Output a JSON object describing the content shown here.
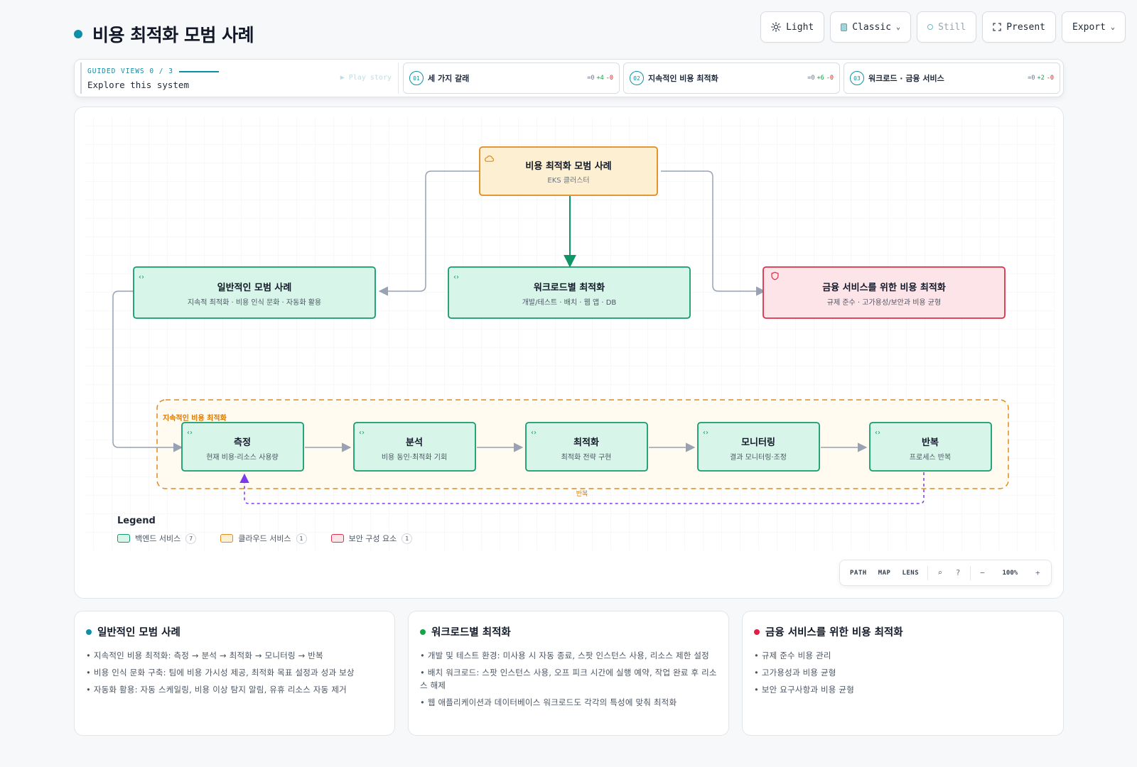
{
  "header": {
    "title": "비용 최적화 모범 사례",
    "accent": "#0e8fa8"
  },
  "toolbar": {
    "theme_label": "Light",
    "style_label": "Classic",
    "motion_label": "Still",
    "present_label": "Present",
    "export_label": "Export"
  },
  "guided": {
    "heading": "GUIDED VIEWS 0 / 3",
    "subtitle": "Explore this system",
    "play_label": "▶ Play story",
    "views": [
      {
        "num": "01",
        "label": "세 가지 갈래",
        "eq": "=0",
        "plus": "+4",
        "minus": "-0"
      },
      {
        "num": "02",
        "label": "지속적인 비용 최적화",
        "eq": "=0",
        "plus": "+6",
        "minus": "-0"
      },
      {
        "num": "03",
        "label": "워크로드 · 금융 서비스",
        "eq": "=0",
        "plus": "+2",
        "minus": "-0"
      }
    ]
  },
  "diagram": {
    "root": {
      "title": "비용 최적화 모범 사례",
      "sub": "EKS 클러스터",
      "kind": "cloud"
    },
    "branches": [
      {
        "title": "일반적인 모범 사례",
        "sub": "지속적 최적화 · 비용 인식 문화 · 자동화 활용",
        "kind": "backend"
      },
      {
        "title": "워크로드별 최적화",
        "sub": "개발/테스트 · 배치 · 웹 앱 · DB",
        "kind": "backend"
      },
      {
        "title": "금융 서비스를 위한 비용 최적화",
        "sub": "규제 준수 · 고가용성/보안과 비용 균형",
        "kind": "security"
      }
    ],
    "group_label": "지속적인 비용 최적화",
    "steps": [
      {
        "title": "측정",
        "sub": "현재 비용·리소스 사용량"
      },
      {
        "title": "분석",
        "sub": "비용 동인·최적화 기회"
      },
      {
        "title": "최적화",
        "sub": "최적화 전략 구현"
      },
      {
        "title": "모니터링",
        "sub": "결과 모니터링·조정"
      },
      {
        "title": "반복",
        "sub": "프로세스 반복"
      }
    ],
    "loop_label": "반복"
  },
  "legend": {
    "title": "Legend",
    "items": [
      {
        "label": "백엔드 서비스",
        "count": "7",
        "kind": "backend"
      },
      {
        "label": "클라우드 서비스",
        "count": "1",
        "kind": "cloud"
      },
      {
        "label": "보안 구성 요소",
        "count": "1",
        "kind": "security"
      }
    ]
  },
  "colors": {
    "backend_fill": "#d8f5ea",
    "backend_stroke": "#159a6b",
    "cloud_fill": "#fdf0d2",
    "cloud_stroke": "#e08a1e",
    "security_fill": "#fde4e8",
    "security_stroke": "#dc2f4a",
    "edge": "#98a2b3",
    "primary_edge": "#0f9466",
    "loop_edge": "#7c3aed"
  },
  "zoom": {
    "path_label": "PATH",
    "map_label": "MAP",
    "lens_label": "LENS",
    "search_icon": "⌕",
    "help_icon": "?",
    "minus": "−",
    "level": "100%",
    "plus": "+"
  },
  "cards": [
    {
      "title": "일반적인 모범 사례",
      "color": "#0e8fa8",
      "items": [
        "지속적인 비용 최적화: 측정 → 분석 → 최적화 → 모니터링 → 반복",
        "비용 인식 문화 구축: 팀에 비용 가시성 제공, 최적화 목표 설정과 성과 보상",
        "자동화 활용: 자동 스케일링, 비용 이상 탐지 알림, 유휴 리소스 자동 제거"
      ]
    },
    {
      "title": "워크로드별 최적화",
      "color": "#16a34a",
      "items": [
        "개발 및 테스트 환경: 미사용 시 자동 종료, 스팟 인스턴스 사용, 리소스 제한 설정",
        "배치 워크로드: 스팟 인스턴스 사용, 오프 피크 시간에 실행 예약, 작업 완료 후 리소스 해제",
        "웹 애플리케이션과 데이터베이스 워크로드도 각각의 특성에 맞춰 최적화"
      ]
    },
    {
      "title": "금융 서비스를 위한 비용 최적화",
      "color": "#e11d48",
      "items": [
        "규제 준수 비용 관리",
        "고가용성과 비용 균형",
        "보안 요구사항과 비용 균형"
      ]
    }
  ]
}
